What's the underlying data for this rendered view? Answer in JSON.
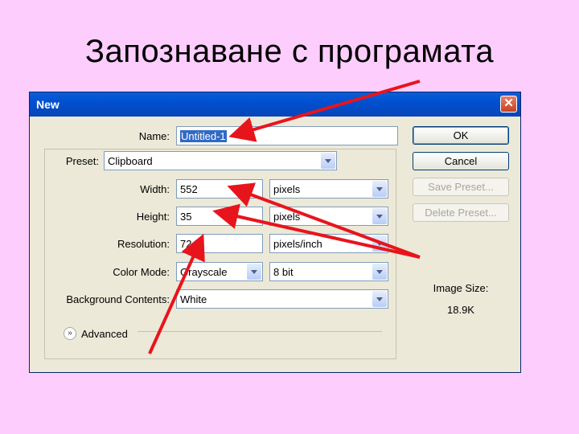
{
  "slide": {
    "title": "Запознаване с програмата"
  },
  "dialog": {
    "title": "New",
    "close_glyph": "✕",
    "name": {
      "label": "Name:",
      "value": "Untitled-1"
    },
    "preset": {
      "label": "Preset:",
      "value": "Clipboard"
    },
    "width": {
      "label": "Width:",
      "value": "552",
      "unit": "pixels"
    },
    "height": {
      "label": "Height:",
      "value": "35",
      "unit": "pixels"
    },
    "resolution": {
      "label": "Resolution:",
      "value": "72",
      "unit": "pixels/inch"
    },
    "color_mode": {
      "label": "Color Mode:",
      "value": "Grayscale",
      "depth": "8 bit"
    },
    "background": {
      "label": "Background Contents:",
      "value": "White"
    },
    "advanced": {
      "label": "Advanced",
      "glyph": "»"
    },
    "buttons": {
      "ok": "OK",
      "cancel": "Cancel",
      "save_preset": "Save Preset...",
      "delete_preset": "Delete Preset..."
    },
    "image_size": {
      "label": "Image Size:",
      "value": "18.9K"
    }
  },
  "colors": {
    "slide_bg": "#FDCDFD",
    "arrow": "#E8141C",
    "titlebar": "#0054E3",
    "dialog_bg": "#ECE9D8"
  },
  "icons": {
    "close": "close-icon",
    "combo": "chevron-down-icon",
    "advanced": "expand-chevrons-icon"
  }
}
